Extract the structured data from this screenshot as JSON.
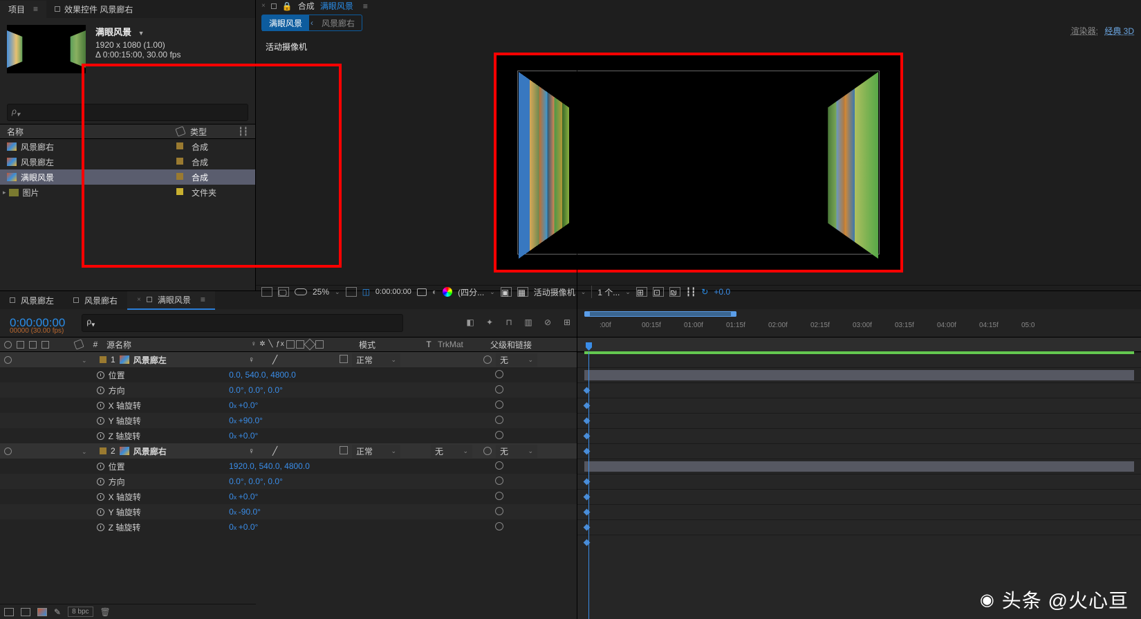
{
  "project": {
    "tab_title": "项目",
    "tab2_title": "效果控件 风景廊右",
    "comp_title": "满眼风景",
    "dims": "1920 x 1080 (1.00)",
    "duration": "Δ 0:00:15:00, 30.00 fps",
    "search_ph": "",
    "col_name": "名称",
    "col_type": "类型",
    "items": [
      {
        "name": "风景廊右",
        "type": "合成",
        "color": "#9a7a30",
        "icon": "comp"
      },
      {
        "name": "风景廊左",
        "type": "合成",
        "color": "#9a7a30",
        "icon": "comp"
      },
      {
        "name": "满眼风景",
        "type": "合成",
        "color": "#9a7a30",
        "icon": "comp",
        "sel": true
      },
      {
        "name": "图片",
        "type": "文件夹",
        "color": "#c8b030",
        "icon": "folder",
        "folder": true
      }
    ],
    "bpc": "8 bpc"
  },
  "comp": {
    "head_label": "合成",
    "head_name": "满眼风景",
    "bc_active": "满眼风景",
    "bc_item2": "风景廊右",
    "renderer_lbl": "渲染器:",
    "renderer_val": "经典 3D",
    "camera_label": "活动摄像机",
    "footer": {
      "zoom": "25%",
      "tc": "0:00:00:00",
      "res": "(四分...",
      "view": "活动摄像机",
      "views": "1 个...",
      "exp": "+0.0"
    }
  },
  "timeline": {
    "tabs": [
      "风景廊左",
      "风景廊右",
      "满眼风景"
    ],
    "active_tab": 2,
    "tc": "0:00:00:00",
    "fps": "00000 (30.00 fps)",
    "cols": {
      "num": "#",
      "src": "源名称",
      "mode": "模式",
      "t": "T",
      "trk": "TrkMat",
      "parent": "父级和链接"
    },
    "ticks": [
      ":00f",
      "00:15f",
      "01:00f",
      "01:15f",
      "02:00f",
      "02:15f",
      "03:00f",
      "03:15f",
      "04:00f",
      "04:15f",
      "05:0"
    ],
    "layers": [
      {
        "n": "1",
        "name": "风景廊左",
        "mode": "正常",
        "parent": "无",
        "props": [
          {
            "name": "位置",
            "val": "0.0, 540.0, 4800.0"
          },
          {
            "name": "方向",
            "val": "0.0°, 0.0°, 0.0°"
          },
          {
            "name": "X 轴旋转",
            "val": "0x +0.0°"
          },
          {
            "name": "Y 轴旋转",
            "val": "0x +90.0°"
          },
          {
            "name": "Z 轴旋转",
            "val": "0x +0.0°"
          }
        ]
      },
      {
        "n": "2",
        "name": "风景廊右",
        "mode": "正常",
        "trk": "无",
        "parent": "无",
        "props": [
          {
            "name": "位置",
            "val": "1920.0, 540.0, 4800.0"
          },
          {
            "name": "方向",
            "val": "0.0°, 0.0°, 0.0°"
          },
          {
            "name": "X 轴旋转",
            "val": "0x +0.0°"
          },
          {
            "name": "Y 轴旋转",
            "val": "0x -90.0°"
          },
          {
            "name": "Z 轴旋转",
            "val": "0x +0.0°"
          }
        ]
      }
    ]
  },
  "wm": "头条 @火心亘"
}
